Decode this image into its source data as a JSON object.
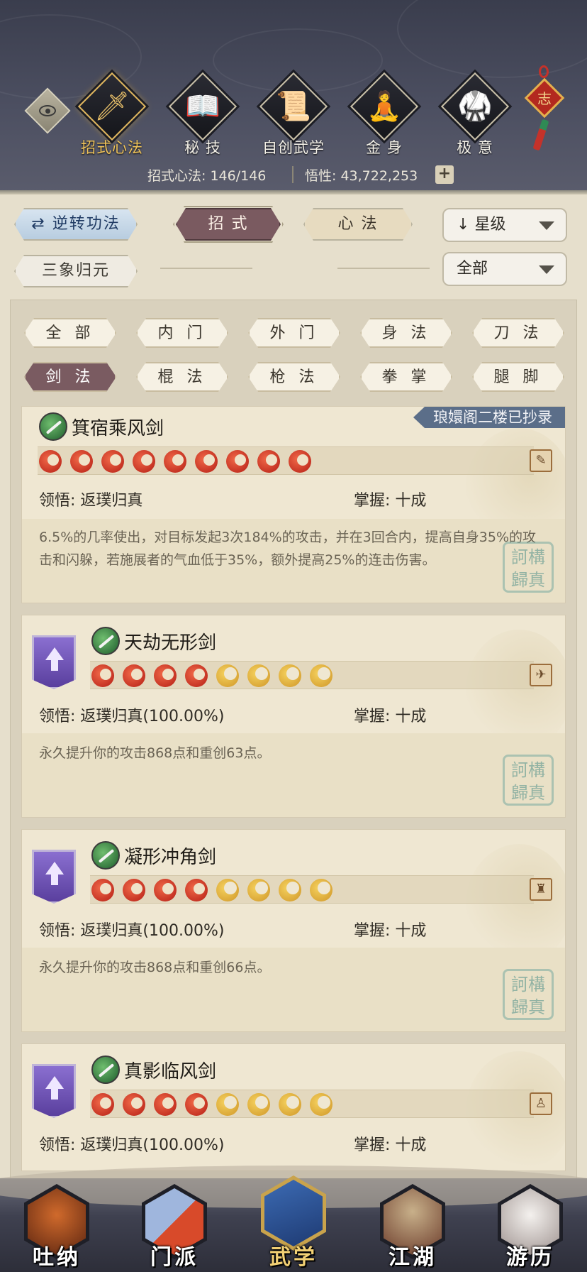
{
  "top_nav": {
    "items": [
      {
        "label": "招式心法",
        "icon": "sword-icon",
        "glyph": "🗡"
      },
      {
        "label": "秘 技",
        "icon": "book-icon",
        "glyph": "📖"
      },
      {
        "label": "自创武学",
        "icon": "scroll-icon",
        "glyph": "📜"
      },
      {
        "label": "金 身",
        "icon": "meditate-icon",
        "glyph": "🧘"
      },
      {
        "label": "极 意",
        "icon": "martial-pose-icon",
        "glyph": "🥋"
      }
    ],
    "charm_char": "志"
  },
  "stats": {
    "moves_label": "招式心法: 146/146",
    "insight_label": "悟性: 43,722,253",
    "plus": "+"
  },
  "filters": {
    "reverse_label": "逆转功法",
    "moves_tab": "招 式",
    "heart_tab": "心 法",
    "sort_select": "星级",
    "sort_prefix": "↓",
    "three_label": "三象归元",
    "scope_select": "全部"
  },
  "categories": [
    "全 部",
    "内 门",
    "外 门",
    "身 法",
    "刀 法",
    "剑 法",
    "棍 法",
    "枪 法",
    "拳 掌",
    "腿 脚"
  ],
  "skills": [
    {
      "name": "箕宿乘风剑",
      "ribbon": "琅嬛阁二楼已抄录",
      "insight": "领悟: 返璞归真",
      "mastery": "掌握: 十成",
      "desc": "6.5%的几率使出，对目标发起3次184%的攻击，并在3回合内，提高自身35%的攻击和闪躲，若施展者的气血低于35%，额外提高25%的连击伤害。",
      "seal": "訶構\n歸真"
    },
    {
      "name": "天劫无形剑",
      "insight": "领悟: 返璞归真(100.00%)",
      "mastery": "掌握: 十成",
      "desc": "永久提升你的攻击868点和重创63点。",
      "seal": "訶構\n歸真"
    },
    {
      "name": "凝形冲角剑",
      "insight": "领悟: 返璞归真(100.00%)",
      "mastery": "掌握: 十成",
      "desc": "永久提升你的攻击868点和重创66点。",
      "seal": "訶構\n歸真"
    },
    {
      "name": "真影临风剑",
      "insight": "领悟: 返璞归真(100.00%)",
      "mastery": "掌握: 十成"
    }
  ],
  "bottom_nav": [
    "吐纳",
    "门派",
    "武学",
    "江湖",
    "游历"
  ],
  "colors": {
    "accent_gold": "#f0c45a",
    "tab_active": "#7a5a60",
    "reverse_btn": "#b8cde0",
    "seal": "#78aaa0"
  }
}
